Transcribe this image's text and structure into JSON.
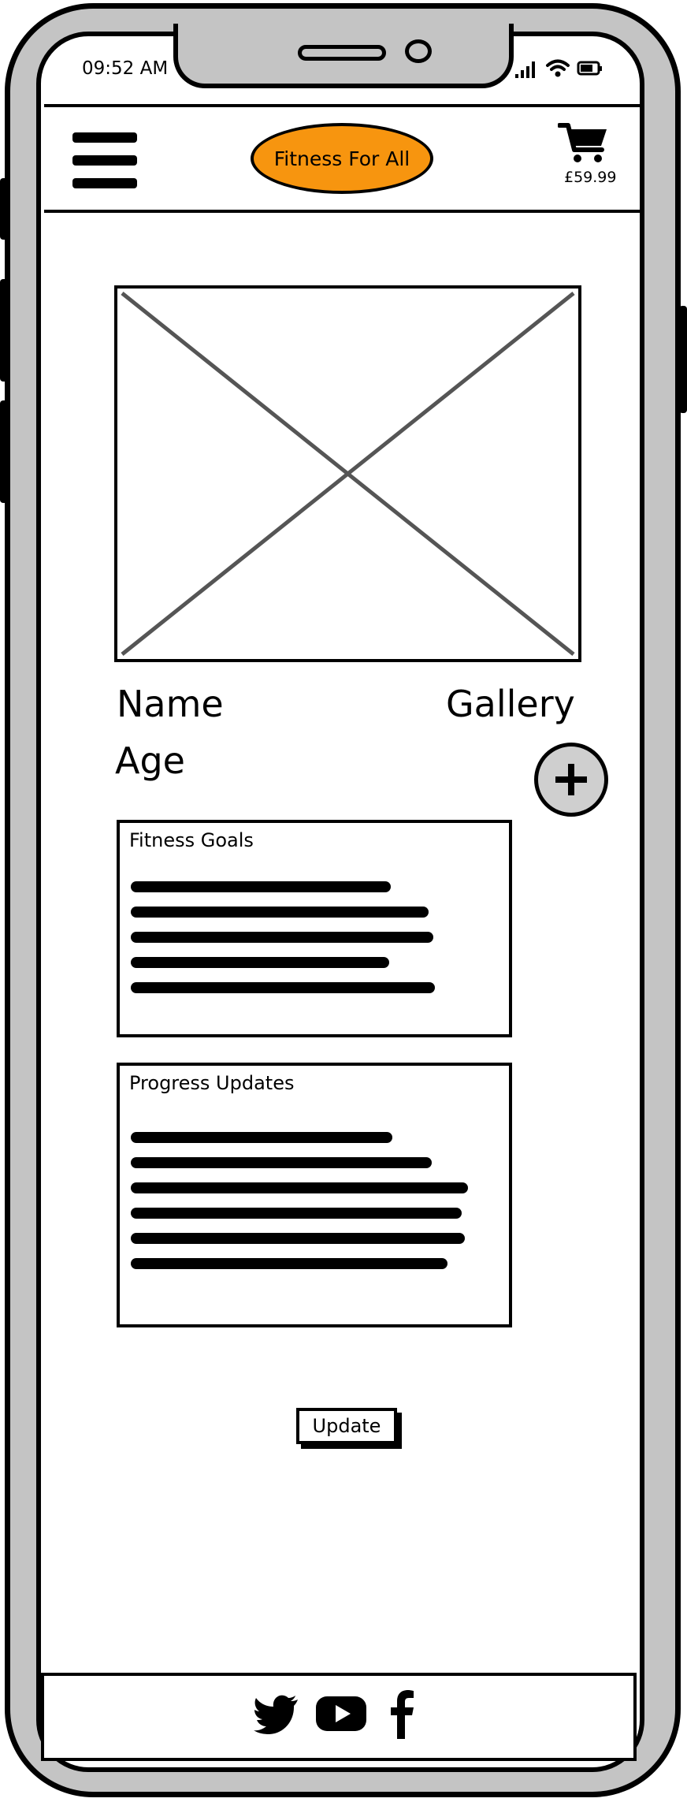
{
  "status_bar": {
    "time": "09:52 AM",
    "icons": [
      "signal-icon",
      "wifi-icon",
      "battery-icon"
    ]
  },
  "header": {
    "menu_icon": "hamburger-menu-icon",
    "brand_label": "Fitness For All",
    "cart_icon": "shopping-cart-icon",
    "cart_total": "£59.99"
  },
  "profile": {
    "image_placeholder": "image-placeholder",
    "name_label": "Name",
    "age_label": "Age",
    "gallery_label": "Gallery",
    "add_icon": "plus-icon"
  },
  "cards": {
    "goals_title": "Fitness Goals",
    "progress_title": "Progress Updates"
  },
  "actions": {
    "update_label": "Update"
  },
  "footer": {
    "social_icons": [
      "twitter-icon",
      "youtube-icon",
      "facebook-icon"
    ]
  },
  "colors": {
    "brand": "#f7950f",
    "frame": "#c4c4c4"
  }
}
